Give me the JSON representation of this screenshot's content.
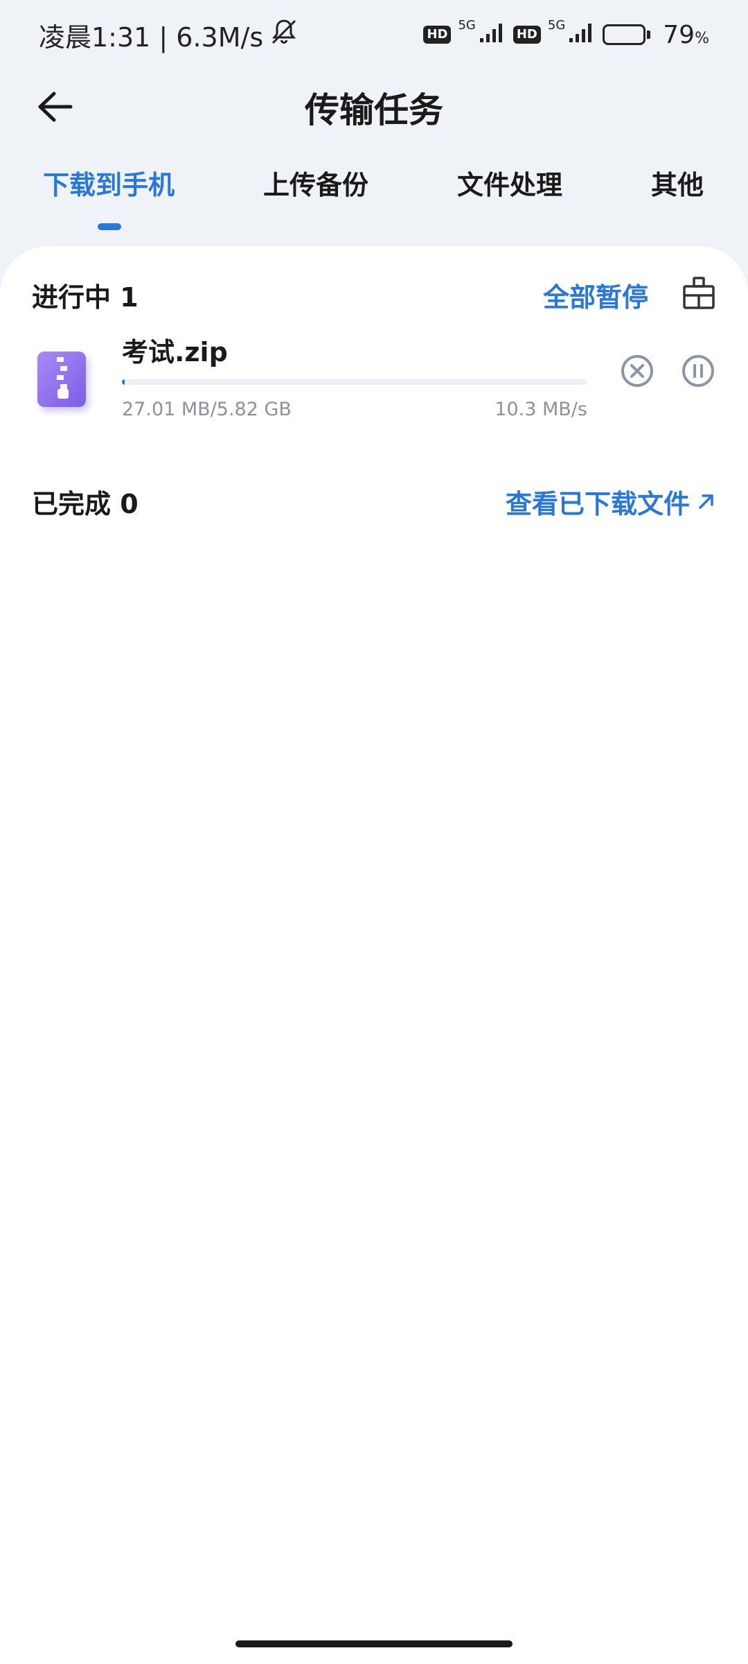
{
  "status_bar": {
    "time_text": "凌晨1:31 | 6.3M/s",
    "hd_label": "HD",
    "network_label": "5G",
    "battery_percent": "79",
    "battery_unit": "%"
  },
  "header": {
    "title": "传输任务"
  },
  "tabs": [
    {
      "label": "下载到手机",
      "active": true
    },
    {
      "label": "上传备份",
      "active": false
    },
    {
      "label": "文件处理",
      "active": false
    },
    {
      "label": "其他",
      "active": false
    }
  ],
  "in_progress": {
    "title": "进行中 1",
    "pause_all_label": "全部暂停",
    "tasks": [
      {
        "file_name": "考试.zip",
        "size_text": "27.01 MB/5.82 GB",
        "speed_text": "10.3 MB/s",
        "progress": 0.005
      }
    ]
  },
  "completed": {
    "title": "已完成 0",
    "view_link_label": "查看已下载文件"
  },
  "colors": {
    "accent": "#2a77d6",
    "background": "#eff2f7",
    "card": "#ffffff",
    "muted_text": "#8b929c"
  },
  "icons": {
    "back": "arrow-left-icon",
    "mute": "bell-off-icon",
    "clean": "broom-icon",
    "cancel": "close-circle-icon",
    "pause": "pause-circle-icon",
    "external": "arrow-up-right-icon",
    "file": "zip-file-icon"
  }
}
